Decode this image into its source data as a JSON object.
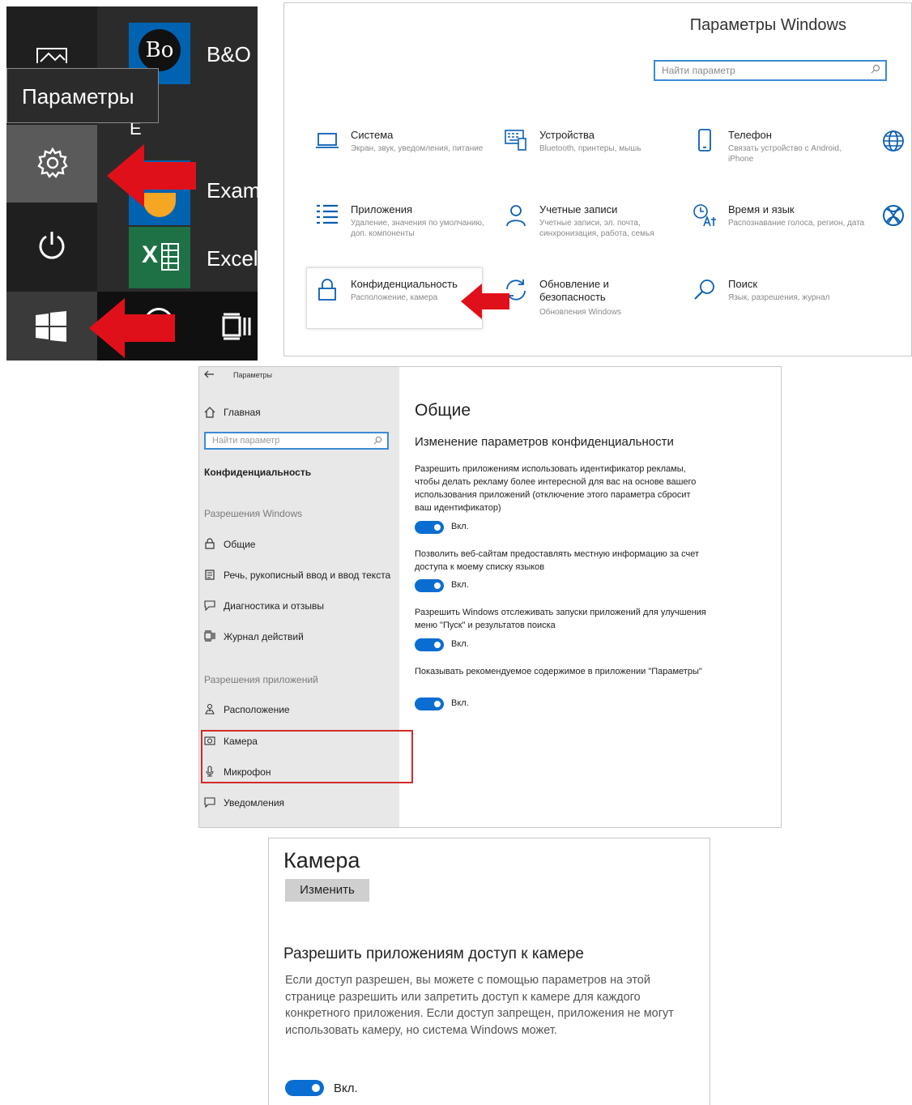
{
  "start_menu": {
    "tooltip": "Параметры",
    "tiles": [
      {
        "label": "B&O",
        "tile_text": "Bo",
        "color": "#0063b1"
      },
      {
        "label": "E",
        "color": "#2b2b2b"
      },
      {
        "label": "Exam",
        "color": "#0063b1"
      },
      {
        "label": "Excel",
        "tile_text": "X",
        "color": "#1e7145"
      }
    ],
    "icons": [
      "image-icon",
      "gear-icon",
      "power-icon",
      "windows-logo-icon",
      "task-view-icon"
    ]
  },
  "settings_home": {
    "title": "Параметры Windows",
    "search_placeholder": "Найти параметр",
    "categories": [
      {
        "title": "Система",
        "desc": "Экран, звук, уведомления, питание",
        "icon": "laptop-icon"
      },
      {
        "title": "Устройства",
        "desc": "Bluetooth, принтеры, мышь",
        "icon": "keyboard-icon"
      },
      {
        "title": "Телефон",
        "desc": "Связать устройство с Android, iPhone",
        "icon": "phone-icon"
      },
      {
        "title": "Приложения",
        "desc": "Удаление, значения по умолчанию, доп. компоненты",
        "icon": "apps-list-icon"
      },
      {
        "title": "Учетные записи",
        "desc": "Учетные записи, эл. почта, синхронизация, работа, семья",
        "icon": "person-icon"
      },
      {
        "title": "Время и язык",
        "desc": "Распознавание голоса, регион, дата",
        "icon": "time-language-icon"
      },
      {
        "title": "Конфиденциальность",
        "desc": "Расположение, камера",
        "icon": "lock-icon"
      },
      {
        "title": "Обновление и безопасность",
        "desc": "Обновления Windows",
        "icon": "sync-icon"
      },
      {
        "title": "Поиск",
        "desc": "Язык, разрешения, журнал",
        "icon": "search-icon"
      }
    ]
  },
  "privacy": {
    "window_title": "Параметры",
    "home": "Главная",
    "search_placeholder": "Найти параметр",
    "section": "Конфиденциальность",
    "group_windows": "Разрешения Windows",
    "windows_items": [
      {
        "label": "Общие",
        "icon": "lock-icon"
      },
      {
        "label": "Речь, рукописный ввод и ввод текста",
        "icon": "notepad-icon"
      },
      {
        "label": "Диагностика и отзывы",
        "icon": "feedback-icon"
      },
      {
        "label": "Журнал действий",
        "icon": "timeline-icon"
      }
    ],
    "group_apps": "Разрешения приложений",
    "app_items": [
      {
        "label": "Расположение",
        "icon": "location-icon"
      },
      {
        "label": "Камера",
        "icon": "camera-icon"
      },
      {
        "label": "Микрофон",
        "icon": "microphone-icon"
      },
      {
        "label": "Уведомления",
        "icon": "notification-icon"
      }
    ],
    "page_title": "Общие",
    "subtitle": "Изменение параметров конфиденциальности",
    "options": [
      {
        "text": "Разрешить приложениям использовать идентификатор рекламы, чтобы делать рекламу более интересной для вас на основе вашего использования приложений (отключение этого параметра сбросит ваш идентификатор)",
        "state": "Вкл."
      },
      {
        "text": "Позволить веб-сайтам предоставлять местную информацию за счет доступа к моему списку языков",
        "state": "Вкл."
      },
      {
        "text": "Разрешить Windows отслеживать запуски приложений для улучшения меню \"Пуск\" и результатов поиска",
        "state": "Вкл."
      },
      {
        "text": "Показывать рекомендуемое содержимое в приложении \"Параметры\"",
        "state": "Вкл."
      }
    ]
  },
  "camera": {
    "title": "Камера",
    "change_button": "Изменить",
    "heading": "Разрешить приложениям доступ к камере",
    "description": "Если доступ разрешен, вы можете с помощью параметров на этой странице разрешить или запретить доступ к камере для каждого конкретного приложения. Если доступ запрещен, приложения не могут использовать камеру, но система Windows может.",
    "toggle_state": "Вкл."
  },
  "colors": {
    "accent": "#0a6dd1",
    "arrow": "#e0101a",
    "highlight": "#d42a2a"
  }
}
